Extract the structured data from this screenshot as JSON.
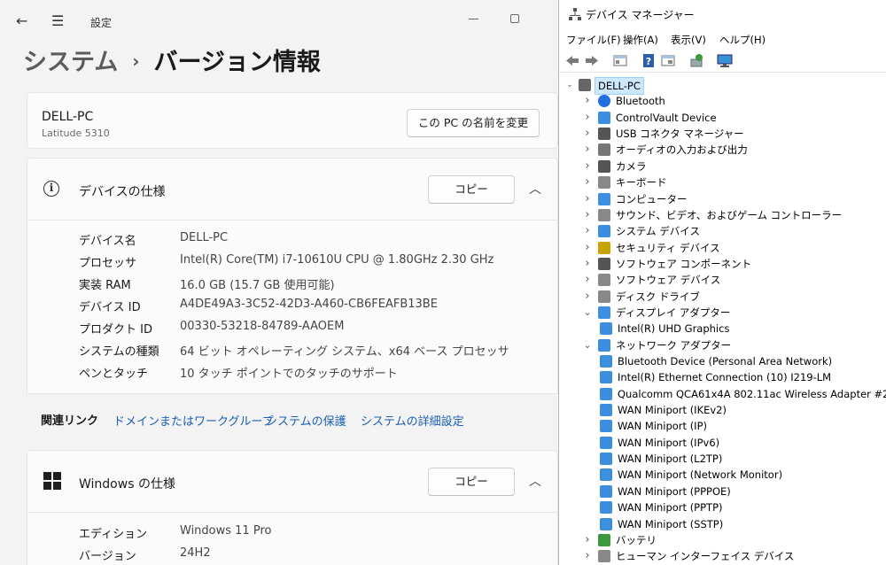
{
  "settings": {
    "window_title": "設定",
    "breadcrumb": {
      "parent": "システム",
      "separator": "›",
      "current": "バージョン情報"
    },
    "pc": {
      "name": "DELL-PC",
      "model": "Latitude 5310",
      "rename_button": "この PC の名前を変更"
    },
    "device_specs": {
      "title": "デバイスの仕様",
      "copy_button": "コピー",
      "rows": [
        {
          "label": "デバイス名",
          "value": "DELL-PC"
        },
        {
          "label": "プロセッサ",
          "value": "Intel(R) Core(TM) i7-10610U CPU @ 1.80GHz   2.30 GHz"
        },
        {
          "label": "実装 RAM",
          "value": "16.0 GB (15.7 GB 使用可能)"
        },
        {
          "label": "デバイス ID",
          "value": "A4DE49A3-3C52-42D3-A460-CB6FEAFB13BE"
        },
        {
          "label": "プロダクト ID",
          "value": "00330-53218-84789-AAOEM"
        },
        {
          "label": "システムの種類",
          "value": "64 ビット オペレーティング システム、x64 ベース プロセッサ"
        },
        {
          "label": "ペンとタッチ",
          "value": "10 タッチ ポイントでのタッチのサポート"
        }
      ]
    },
    "related_links": {
      "label": "関連リンク",
      "links": [
        "ドメインまたはワークグループ",
        "システムの保護",
        "システムの詳細設定"
      ]
    },
    "windows_specs": {
      "title": "Windows の仕様",
      "copy_button": "コピー",
      "rows": [
        {
          "label": "エディション",
          "value": "Windows 11 Pro"
        },
        {
          "label": "バージョン",
          "value": "24H2"
        }
      ]
    }
  },
  "device_manager": {
    "title": "デバイス マネージャー",
    "menu": [
      "ファイル(F)",
      "操作(A)",
      "表示(V)",
      "ヘルプ(H)"
    ],
    "root": "DELL-PC",
    "categories": [
      "Bluetooth",
      "ControlVault Device",
      "USB コネクタ マネージャー",
      "オーディオの入力および出力",
      "カメラ",
      "キーボード",
      "コンピューター",
      "サウンド、ビデオ、およびゲーム コントローラー",
      "システム デバイス",
      "セキュリティ デバイス",
      "ソフトウェア コンポーネント",
      "ソフトウェア デバイス",
      "ディスク ドライブ",
      "ディスプレイ アダプター",
      "Intel(R) UHD Graphics",
      "ネットワーク アダプター",
      "Bluetooth Device (Personal Area Network)",
      "Intel(R) Ethernet Connection (10) I219-LM",
      "Qualcomm QCA61x4A 802.11ac Wireless Adapter #2",
      "WAN Miniport (IKEv2)",
      "WAN Miniport (IP)",
      "WAN Miniport (IPv6)",
      "WAN Miniport (L2TP)",
      "WAN Miniport (Network Monitor)",
      "WAN Miniport (PPPOE)",
      "WAN Miniport (PPTP)",
      "WAN Miniport (SSTP)",
      "バッテリ",
      "ヒューマン インターフェイス デバイス"
    ]
  }
}
